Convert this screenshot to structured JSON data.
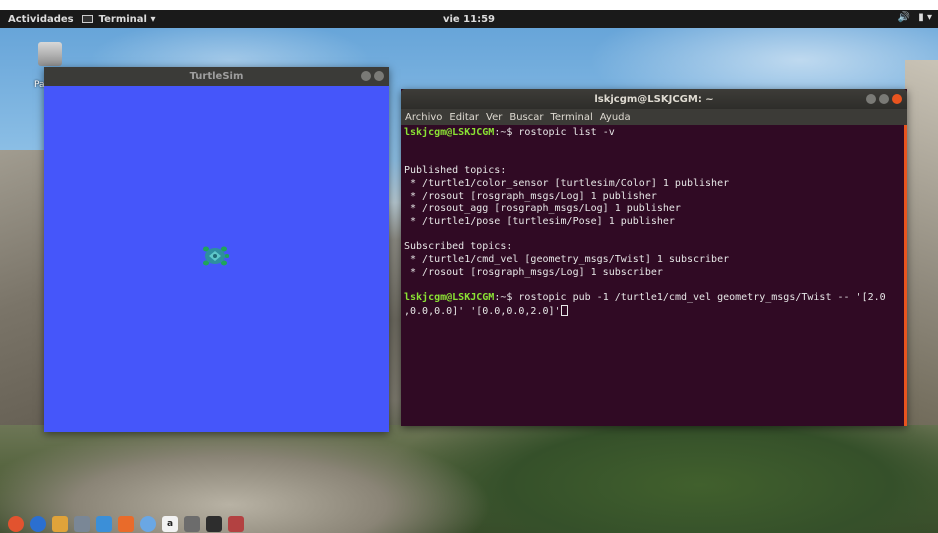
{
  "topbar": {
    "activities": "Actividades",
    "app_menu": "Terminal ▾",
    "clock": "vie 11:59",
    "tray_volume": "🔊",
    "tray_battery": "▮ ▾"
  },
  "desktop": {
    "icon_label": "Pa"
  },
  "turtlesim": {
    "title": "TurtleSim",
    "background_color": "#4556fa"
  },
  "terminal": {
    "title": "lskjcgm@LSKJCGM: ~",
    "menu": [
      "Archivo",
      "Editar",
      "Ver",
      "Buscar",
      "Terminal",
      "Ayuda"
    ],
    "prompt": "lskjcgm@LSKJCGM",
    "prompt_suffix": ":~$ ",
    "command1": "rostopic list -v",
    "published_header": "Published topics:",
    "published": [
      " * /turtle1/color_sensor [turtlesim/Color] 1 publisher",
      " * /rosout [rosgraph_msgs/Log] 1 publisher",
      " * /rosout_agg [rosgraph_msgs/Log] 1 publisher",
      " * /turtle1/pose [turtlesim/Pose] 1 publisher"
    ],
    "subscribed_header": "Subscribed topics:",
    "subscribed": [
      " * /turtle1/cmd_vel [geometry_msgs/Twist] 1 subscriber",
      " * /rosout [rosgraph_msgs/Log] 1 subscriber"
    ],
    "command2_line1": "rostopic pub -1 /turtle1/cmd_vel geometry_msgs/Twist -- '[2.0",
    "command2_line2": ",0.0,0.0]' '[0.0,0.0,2.0]'"
  },
  "dock": {
    "items": [
      "ubuntu-icon",
      "firefox-icon",
      "files-icon",
      "terminal-icon",
      "docs-icon",
      "software-icon",
      "amazon-icon",
      "settings-icon",
      "text-icon",
      "terminal2-icon"
    ],
    "amazon_label": "a"
  },
  "colors": {
    "terminal_bg": "#300a24",
    "prompt": "#8ae234",
    "accent": "#e9541f"
  }
}
